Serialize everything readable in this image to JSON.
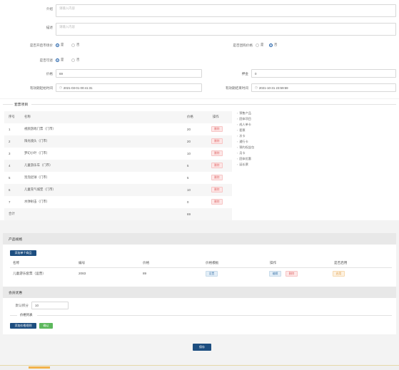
{
  "form": {
    "intro_label": "介绍",
    "intro_placeholder": "请输入内容",
    "desc_label": "描述",
    "desc_placeholder": "请输入内容",
    "market_price_label": "是否开启市场价",
    "market_yes": "是",
    "market_no": "否",
    "group_price_label": "是否团购价格",
    "group_yes": "是",
    "group_no": "否",
    "available_label": "是否可退",
    "avail_yes": "是",
    "avail_no": "否",
    "price_label": "价格",
    "price_value": "69",
    "deposit_label": "押金",
    "deposit_value": "0",
    "start_label": "有效期起始时间",
    "start_value": "2021-03-01 00:41:31",
    "end_label": "有效期结束时间",
    "end_value": "2021-10-31 23:59:59"
  },
  "package": {
    "section_title": "套票项目",
    "headers": [
      "序号",
      "名称",
      "价格",
      "操作"
    ],
    "rows": [
      {
        "no": "1",
        "name": "视频游戏门票（门市）",
        "price": "20",
        "action": "删除"
      },
      {
        "no": "2",
        "name": "阳光镜头（门市）",
        "price": "20",
        "action": "删除"
      },
      {
        "no": "3",
        "name": "梦幻小叶（门市）",
        "price": "10",
        "action": "删除"
      },
      {
        "no": "4",
        "name": "儿童游乐车（门市）",
        "price": "5",
        "action": "删除"
      },
      {
        "no": "5",
        "name": "泡泡足球（门市）",
        "price": "5",
        "action": "删除"
      },
      {
        "no": "6",
        "name": "儿童充气城堡（门市）",
        "price": "10",
        "action": "删除"
      },
      {
        "no": "7",
        "name": "水弹射击（门市）",
        "price": "0",
        "action": "删除"
      }
    ],
    "total_label": "合计",
    "total_value": "69"
  },
  "tree": {
    "items": [
      "预售产品",
      "团体项目",
      "成人单卡",
      "套票",
      "次卡",
      "通行卡",
      "预约权益包",
      "月卡",
      "团体优惠",
      "延长票"
    ]
  },
  "product": {
    "section_title": "产品规格",
    "add_button": "添加单个商品",
    "headers": [
      "名称",
      "编号",
      "价格",
      "价格模板",
      "操作",
      "是否启用"
    ],
    "row": {
      "name": "儿童游乐套票（运营）",
      "code": "2083",
      "price": "89",
      "template": "设置",
      "edit": "编辑",
      "delete": "删除",
      "enable": "启用"
    }
  },
  "member": {
    "section_title": "会员优惠",
    "points_label": "默认积分",
    "points_value": "10",
    "price_list_label": "价格列表",
    "add_price_button": "添加价格规则",
    "confirm_button": "确认"
  },
  "footer": {
    "save_button": "保存"
  },
  "colors": {
    "primary": "#1d4e80",
    "danger_bg": "#fde7e7",
    "success": "#5cb85c"
  }
}
